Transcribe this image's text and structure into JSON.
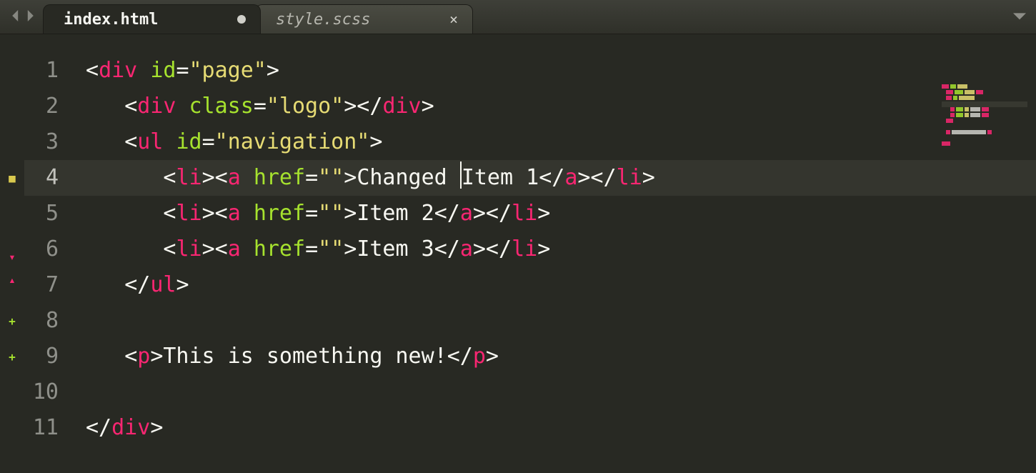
{
  "tabs": {
    "back_icon": "◀",
    "fwd_icon": "▶",
    "more_icon": "▼",
    "items": [
      {
        "label": "index.html",
        "dirty": true,
        "active": true
      },
      {
        "label": "style.scss",
        "dirty": false,
        "active": false
      }
    ]
  },
  "theme": {
    "background": "#282923",
    "tag": "#f92672",
    "attr": "#a6e22e",
    "string": "#e6db74",
    "text": "#f8f8f2",
    "gutter": "#8f908a"
  },
  "editor": {
    "active_line": 4,
    "lines": [
      {
        "n": 1,
        "diff": "",
        "indent": 0,
        "tokens": [
          [
            "p",
            "<"
          ],
          [
            "tg",
            "div"
          ],
          [
            "p",
            " "
          ],
          [
            "at",
            "id"
          ],
          [
            "p",
            "="
          ],
          [
            "st",
            "\"page\""
          ],
          [
            "p",
            ">"
          ]
        ]
      },
      {
        "n": 2,
        "diff": "",
        "indent": 1,
        "tokens": [
          [
            "p",
            "<"
          ],
          [
            "tg",
            "div"
          ],
          [
            "p",
            " "
          ],
          [
            "at",
            "class"
          ],
          [
            "p",
            "="
          ],
          [
            "st",
            "\"logo\""
          ],
          [
            "p",
            "></"
          ],
          [
            "tg",
            "div"
          ],
          [
            "p",
            ">"
          ]
        ]
      },
      {
        "n": 3,
        "diff": "",
        "indent": 1,
        "tokens": [
          [
            "p",
            "<"
          ],
          [
            "tg",
            "ul"
          ],
          [
            "p",
            " "
          ],
          [
            "at",
            "id"
          ],
          [
            "p",
            "="
          ],
          [
            "st",
            "\"navigation\""
          ],
          [
            "p",
            ">"
          ]
        ]
      },
      {
        "n": 4,
        "diff": "mod",
        "indent": 2,
        "tokens": [
          [
            "p",
            "<"
          ],
          [
            "tg",
            "li"
          ],
          [
            "p",
            "><"
          ],
          [
            "tg",
            "a"
          ],
          [
            "p",
            " "
          ],
          [
            "at",
            "href"
          ],
          [
            "p",
            "="
          ],
          [
            "st",
            "\"\""
          ],
          [
            "p",
            ">"
          ],
          [
            "tx",
            "Changed "
          ],
          [
            "cursor",
            ""
          ],
          [
            "tx",
            "Item 1"
          ],
          [
            "p",
            "</"
          ],
          [
            "tg",
            "a"
          ],
          [
            "p",
            "></"
          ],
          [
            "tg",
            "li"
          ],
          [
            "p",
            ">"
          ]
        ]
      },
      {
        "n": 5,
        "diff": "",
        "indent": 2,
        "tokens": [
          [
            "p",
            "<"
          ],
          [
            "tg",
            "li"
          ],
          [
            "p",
            "><"
          ],
          [
            "tg",
            "a"
          ],
          [
            "p",
            " "
          ],
          [
            "at",
            "href"
          ],
          [
            "p",
            "="
          ],
          [
            "st",
            "\"\""
          ],
          [
            "p",
            ">"
          ],
          [
            "tx",
            "Item 2"
          ],
          [
            "p",
            "</"
          ],
          [
            "tg",
            "a"
          ],
          [
            "p",
            "></"
          ],
          [
            "tg",
            "li"
          ],
          [
            "p",
            ">"
          ]
        ]
      },
      {
        "n": 6,
        "diff": "del",
        "indent": 2,
        "tokens": [
          [
            "p",
            "<"
          ],
          [
            "tg",
            "li"
          ],
          [
            "p",
            "><"
          ],
          [
            "tg",
            "a"
          ],
          [
            "p",
            " "
          ],
          [
            "at",
            "href"
          ],
          [
            "p",
            "="
          ],
          [
            "st",
            "\"\""
          ],
          [
            "p",
            ">"
          ],
          [
            "tx",
            "Item 3"
          ],
          [
            "p",
            "</"
          ],
          [
            "tg",
            "a"
          ],
          [
            "p",
            "></"
          ],
          [
            "tg",
            "li"
          ],
          [
            "p",
            ">"
          ]
        ]
      },
      {
        "n": 7,
        "diff": "del2",
        "indent": 1,
        "tokens": [
          [
            "p",
            "</"
          ],
          [
            "tg",
            "ul"
          ],
          [
            "p",
            ">"
          ]
        ]
      },
      {
        "n": 8,
        "diff": "add",
        "indent": 0,
        "tokens": []
      },
      {
        "n": 9,
        "diff": "add",
        "indent": 1,
        "tokens": [
          [
            "p",
            "<"
          ],
          [
            "tg",
            "p"
          ],
          [
            "p",
            ">"
          ],
          [
            "tx",
            "This is something new!"
          ],
          [
            "p",
            "</"
          ],
          [
            "tg",
            "p"
          ],
          [
            "p",
            ">"
          ]
        ]
      },
      {
        "n": 10,
        "diff": "",
        "indent": 0,
        "tokens": []
      },
      {
        "n": 11,
        "diff": "",
        "indent": 0,
        "tokens": [
          [
            "p",
            "</"
          ],
          [
            "tg",
            "div"
          ],
          [
            "p",
            ">"
          ]
        ]
      }
    ]
  }
}
